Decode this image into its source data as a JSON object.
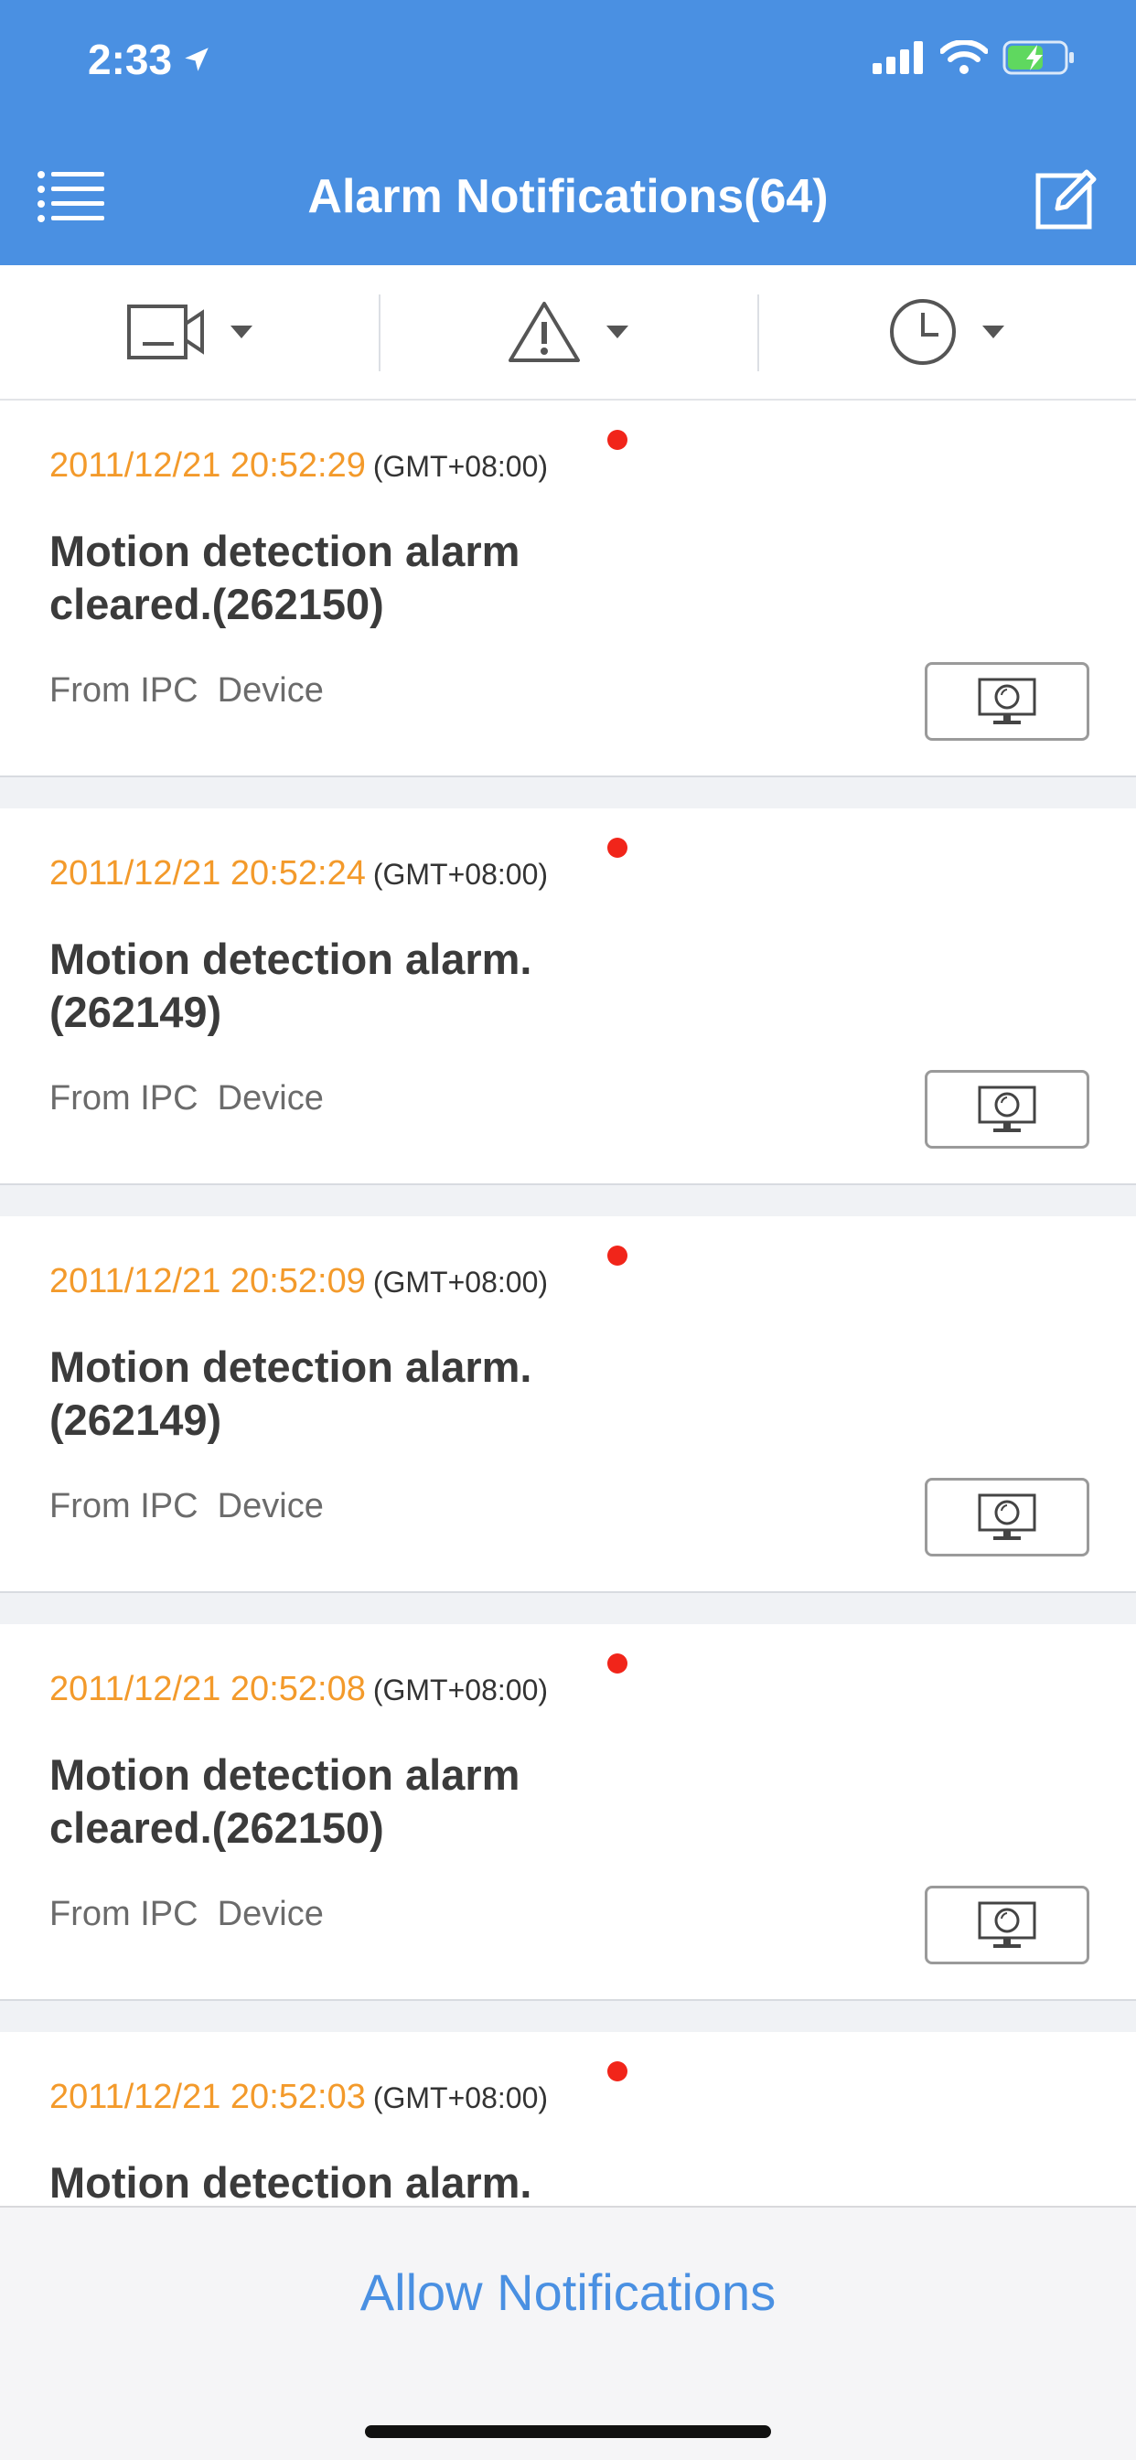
{
  "status_bar": {
    "time": "2:33"
  },
  "header": {
    "title": "Alarm Notifications(64)"
  },
  "filters": [
    {
      "icon": "camera-icon"
    },
    {
      "icon": "warning-icon"
    },
    {
      "icon": "clock-icon"
    }
  ],
  "alarms": [
    {
      "time": "2011/12/21 20:52:29",
      "tz": "(GMT+08:00)",
      "message": "Motion detection alarm cleared.(262150)",
      "from": "From IPC  Device"
    },
    {
      "time": "2011/12/21 20:52:24",
      "tz": "(GMT+08:00)",
      "message": "Motion detection alarm.(262149)",
      "from": "From IPC  Device"
    },
    {
      "time": "2011/12/21 20:52:09",
      "tz": "(GMT+08:00)",
      "message": "Motion detection alarm.(262149)",
      "from": "From IPC  Device"
    },
    {
      "time": "2011/12/21 20:52:08",
      "tz": "(GMT+08:00)",
      "message": "Motion detection alarm cleared.(262150)",
      "from": "From IPC  Device"
    },
    {
      "time": "2011/12/21 20:52:03",
      "tz": "(GMT+08:00)",
      "message": "Motion detection alarm.",
      "from": ""
    }
  ],
  "bottom": {
    "allow_label": "Allow Notifications"
  },
  "colors": {
    "header": "#4a90e2",
    "time": "#f39a2b",
    "unread_dot": "#f1251a"
  }
}
